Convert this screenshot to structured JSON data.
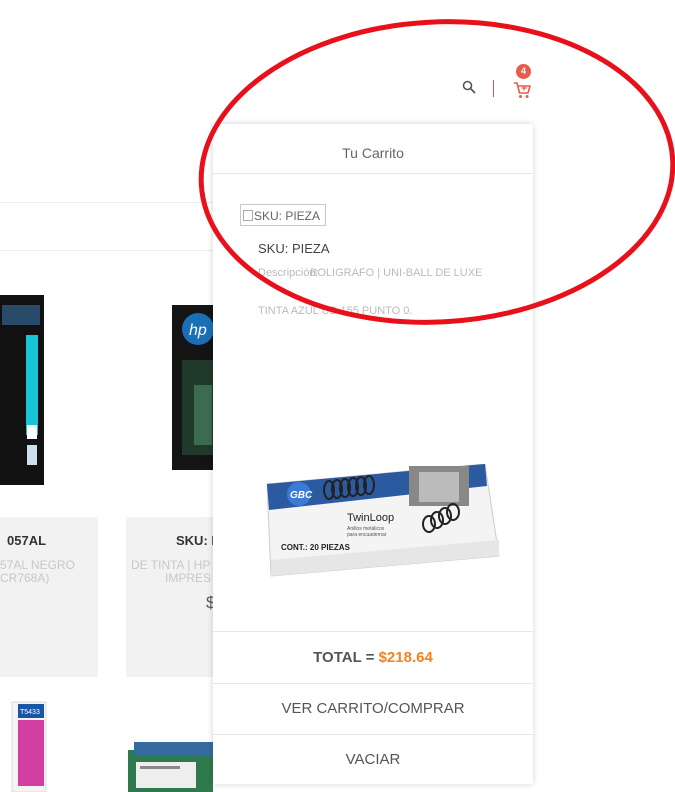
{
  "header": {
    "search_icon": "search-icon",
    "cart_icon": "cart-icon",
    "cart_count": "4",
    "accent": "#e85c4a"
  },
  "background": {
    "card1_sku": "057AL",
    "card1_desc_line1": "57AL NEGRO",
    "card1_desc_line2": "CR768A)",
    "card2_sku": "SKU: I",
    "card2_desc_line1": "DE TINTA | HP",
    "card2_desc_line2": "IMPRES",
    "card2_price": "$"
  },
  "cart": {
    "title": "Tu Carrito",
    "item": {
      "image_alt": "SKU: PIEZA",
      "sku": "SKU: PIEZA",
      "desc_label": "Descripción:",
      "desc_line1": "BOLIGRAFO | UNI-BALL DE LUXE",
      "desc_line2": "TINTA AZUL UB-155 PUNTO 0."
    },
    "second_item": {
      "brand": "GBC",
      "product": "TwinLoop",
      "subtitle_line1": "Anillos metálicos",
      "subtitle_line2": "para encuadernar",
      "content": "CONT.: 20 PIEZAS"
    },
    "total_label": "TOTAL = ",
    "total_value": "$218.64",
    "total_color": "#f5821f",
    "view_cart_button": "VER CARRITO/COMPRAR",
    "empty_button": "VACIAR"
  }
}
